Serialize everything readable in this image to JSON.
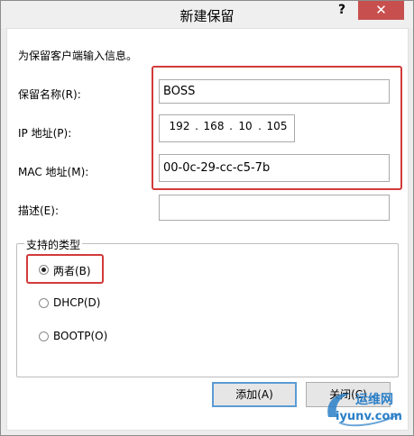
{
  "window": {
    "title": "新建保留",
    "help_glyph": "?",
    "close_glyph": "✕"
  },
  "form": {
    "intro": "为保留客户端输入信息。",
    "name_label": "保留名称(R):",
    "name_value": "BOSS",
    "ip_label": "IP 地址(P):",
    "ip_octets": [
      "192",
      "168",
      "10",
      "105"
    ],
    "ip_dot": ".",
    "mac_label": "MAC 地址(M):",
    "mac_value": "00-0c-29-cc-c5-7b",
    "desc_label": "描述(E):",
    "desc_value": ""
  },
  "types": {
    "legend": "支持的类型",
    "options": [
      {
        "label": "两者(B)",
        "selected": true
      },
      {
        "label": "DHCP(D)",
        "selected": false
      },
      {
        "label": "BOOTP(O)",
        "selected": false
      }
    ]
  },
  "buttons": {
    "add_label": "添加(A)",
    "close_label": "关闭(C)"
  },
  "watermark": {
    "line1": "运维网",
    "line2": "iyunv.com"
  },
  "colors": {
    "highlight": "#d23a3a",
    "close_button": "#c7504f",
    "default_button_border": "#5b9bd5"
  }
}
